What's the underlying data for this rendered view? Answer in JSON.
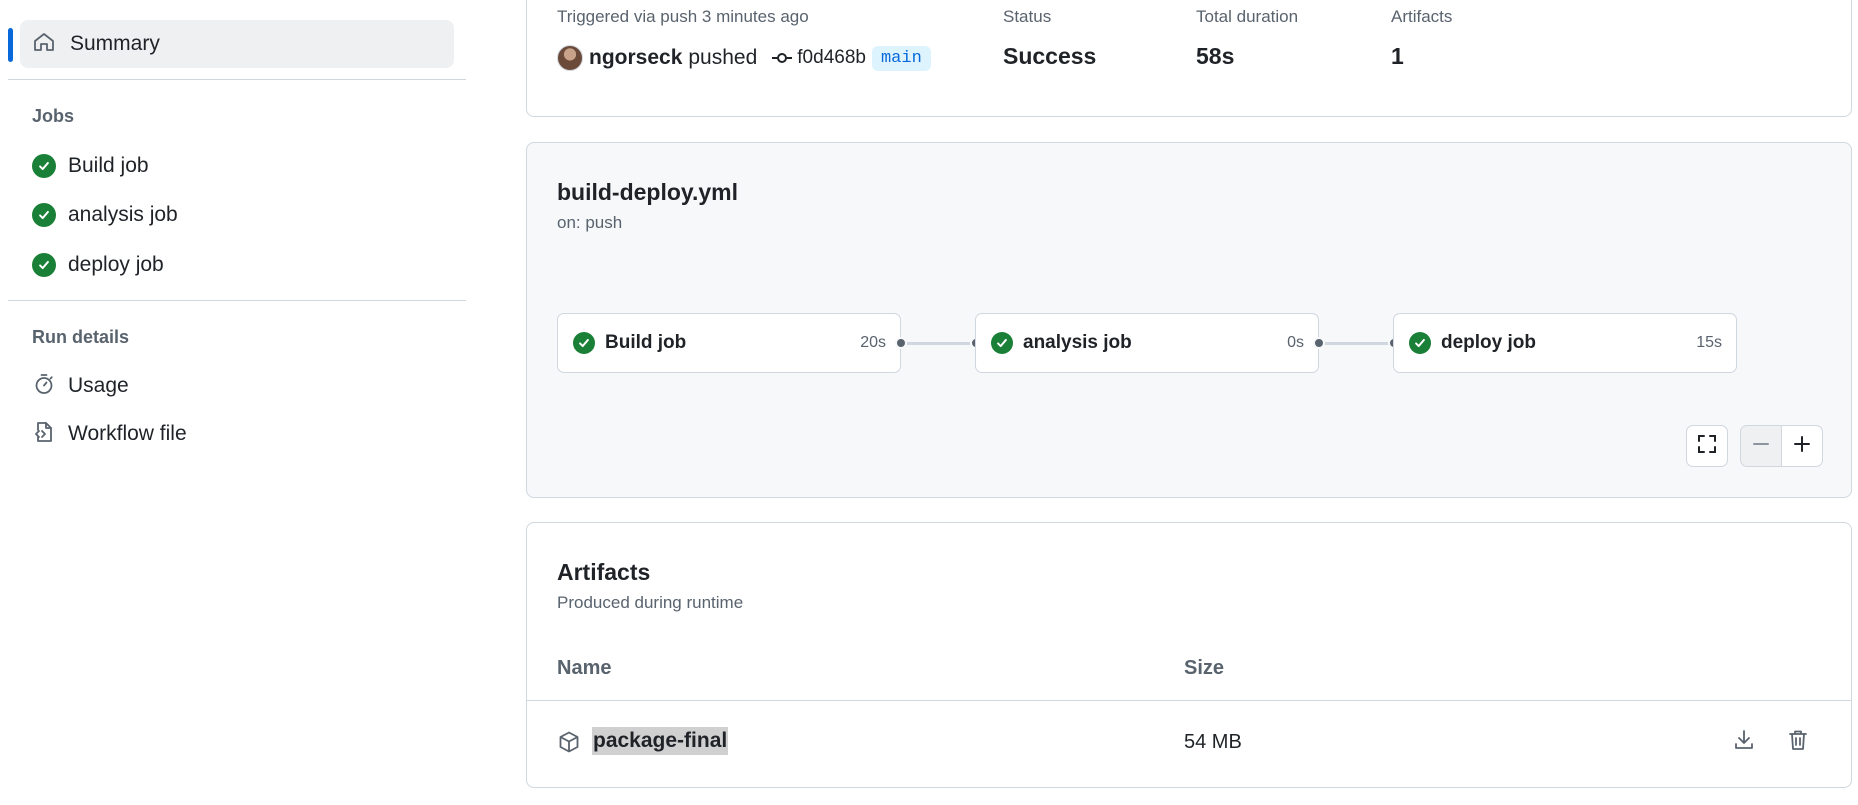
{
  "sidebar": {
    "summary_label": "Summary",
    "jobs_title": "Jobs",
    "jobs": [
      {
        "label": "Build job",
        "status": "success"
      },
      {
        "label": "analysis job",
        "status": "success"
      },
      {
        "label": "deploy job",
        "status": "success"
      }
    ],
    "run_details_title": "Run details",
    "run_details": [
      {
        "label": "Usage",
        "icon": "stopwatch-icon"
      },
      {
        "label": "Workflow file",
        "icon": "file-code-icon"
      }
    ]
  },
  "run_summary": {
    "trigger_text": "Triggered via push 3 minutes ago",
    "user": "ngorseck",
    "action": "pushed",
    "commit_sha": "f0d468b",
    "branch": "main",
    "status_label": "Status",
    "status_value": "Success",
    "duration_label": "Total duration",
    "duration_value": "58s",
    "artifacts_label": "Artifacts",
    "artifacts_value": "1"
  },
  "workflow": {
    "file": "build-deploy.yml",
    "trigger": "on: push",
    "jobs": [
      {
        "name": "Build job",
        "duration": "20s",
        "status": "success"
      },
      {
        "name": "analysis job",
        "duration": "0s",
        "status": "success"
      },
      {
        "name": "deploy job",
        "duration": "15s",
        "status": "success"
      }
    ]
  },
  "artifacts": {
    "title": "Artifacts",
    "subtitle": "Produced during runtime",
    "columns": {
      "name": "Name",
      "size": "Size"
    },
    "rows": [
      {
        "name": "package-final",
        "size": "54 MB"
      }
    ]
  },
  "colors": {
    "success": "#1a7f37",
    "accent": "#0969da",
    "branch_bg": "#ddf4ff"
  }
}
